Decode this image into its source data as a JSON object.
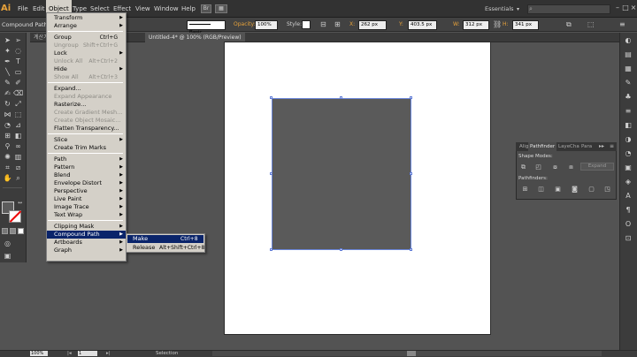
{
  "app": {
    "logo": "Ai"
  },
  "menubar": {
    "items": [
      "File",
      "Edit",
      "Object",
      "Type",
      "Select",
      "Effect",
      "View",
      "Window",
      "Help"
    ],
    "workspace": "Essentials",
    "window_controls": [
      "–",
      "□",
      "×"
    ]
  },
  "controlbar": {
    "selection_label": "Compound Path",
    "stroke_style": "Basic",
    "opacity_label": "Opacity:",
    "opacity_value": "100%",
    "style_label": "Style:",
    "x_label": "X:",
    "x_value": "262 px",
    "y_label": "Y:",
    "y_value": "403.5 px",
    "w_label": "W:",
    "w_value": "312 px",
    "h_label": "H:",
    "h_value": "341 px"
  },
  "tabs": [
    {
      "label": "계산기.ai @ 100% (RGB/Preview)",
      "active": false
    },
    {
      "label": "Untitled-4* @ 100% (RGB/Preview)",
      "active": true
    }
  ],
  "object_menu": {
    "items": [
      {
        "label": "Transform",
        "submenu": true,
        "enabled": true
      },
      {
        "label": "Arrange",
        "submenu": true,
        "enabled": true
      },
      {
        "sep": true
      },
      {
        "label": "Group",
        "shortcut": "Ctrl+G",
        "enabled": true
      },
      {
        "label": "Ungroup",
        "shortcut": "Shift+Ctrl+G",
        "enabled": false
      },
      {
        "label": "Lock",
        "submenu": true,
        "enabled": true
      },
      {
        "label": "Unlock All",
        "shortcut": "Alt+Ctrl+2",
        "enabled": false
      },
      {
        "label": "Hide",
        "submenu": true,
        "enabled": true
      },
      {
        "label": "Show All",
        "shortcut": "Alt+Ctrl+3",
        "enabled": false
      },
      {
        "sep": true
      },
      {
        "label": "Expand...",
        "enabled": true
      },
      {
        "label": "Expand Appearance",
        "enabled": false
      },
      {
        "label": "Rasterize...",
        "enabled": true
      },
      {
        "label": "Create Gradient Mesh...",
        "enabled": false
      },
      {
        "label": "Create Object Mosaic...",
        "enabled": false
      },
      {
        "label": "Flatten Transparency...",
        "enabled": true
      },
      {
        "sep": true
      },
      {
        "label": "Slice",
        "submenu": true,
        "enabled": true
      },
      {
        "label": "Create Trim Marks",
        "enabled": true
      },
      {
        "sep": true
      },
      {
        "label": "Path",
        "submenu": true,
        "enabled": true
      },
      {
        "label": "Pattern",
        "submenu": true,
        "enabled": true
      },
      {
        "label": "Blend",
        "submenu": true,
        "enabled": true
      },
      {
        "label": "Envelope Distort",
        "submenu": true,
        "enabled": true
      },
      {
        "label": "Perspective",
        "submenu": true,
        "enabled": true
      },
      {
        "label": "Live Paint",
        "submenu": true,
        "enabled": true
      },
      {
        "label": "Image Trace",
        "submenu": true,
        "enabled": true
      },
      {
        "label": "Text Wrap",
        "submenu": true,
        "enabled": true
      },
      {
        "sep": true
      },
      {
        "label": "Clipping Mask",
        "submenu": true,
        "enabled": true
      },
      {
        "label": "Compound Path",
        "submenu": true,
        "enabled": true,
        "highlighted": true
      },
      {
        "label": "Artboards",
        "submenu": true,
        "enabled": true
      },
      {
        "label": "Graph",
        "submenu": true,
        "enabled": true
      }
    ]
  },
  "compound_path_submenu": {
    "items": [
      {
        "label": "Make",
        "shortcut": "Ctrl+8",
        "highlighted": true
      },
      {
        "label": "Release",
        "shortcut": "Alt+Shift+Ctrl+8",
        "highlighted": false
      }
    ]
  },
  "pathfinder_panel": {
    "tabs": [
      "Alig",
      "Pathfinder",
      "Laye",
      "Cha",
      "Para"
    ],
    "shape_modes_label": "Shape Modes:",
    "expand_label": "Expand",
    "pathfinders_label": "Pathfinders:"
  },
  "statusbar": {
    "zoom": "100%",
    "artboard": "1",
    "tool": "Selection"
  },
  "colors": {
    "accent_highlight": "#0a246a",
    "menu_bg": "#d4d0c8",
    "selection": "#6a86d8",
    "logo": "#e8a23a"
  }
}
